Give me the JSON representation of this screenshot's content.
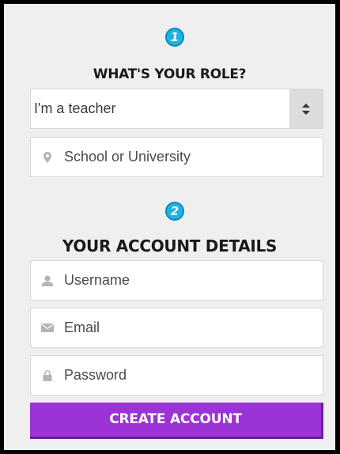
{
  "role_section": {
    "step_number": "1",
    "heading": "WHAT'S YOUR ROLE?",
    "role_select": {
      "selected": "I'm a teacher",
      "icon": "select-arrows-icon"
    },
    "school_field": {
      "placeholder": "School or University",
      "icon": "location-pin-icon"
    }
  },
  "account_section": {
    "step_number": "2",
    "heading": "YOUR ACCOUNT DETAILS",
    "username_field": {
      "placeholder": "Username",
      "icon": "user-icon"
    },
    "email_field": {
      "placeholder": "Email",
      "icon": "envelope-icon"
    },
    "password_field": {
      "placeholder": "Password",
      "icon": "lock-icon"
    }
  },
  "create_button": {
    "label": "CREATE ACCOUNT"
  },
  "colors": {
    "accent_purple": "#9b33d6",
    "step_badge_blue": "#1db3e3",
    "panel_background": "#efefef",
    "frame_border": "#000000"
  }
}
